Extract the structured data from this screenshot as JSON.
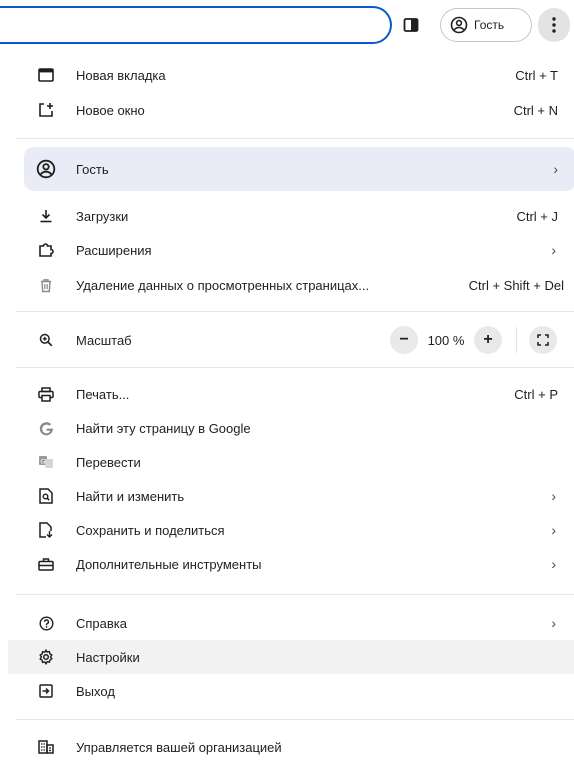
{
  "toolbar": {
    "profile_label": "Гость"
  },
  "menu": {
    "new_tab": {
      "label": "Новая вкладка",
      "shortcut": "Ctrl + T"
    },
    "new_window": {
      "label": "Новое окно",
      "shortcut": "Ctrl + N"
    },
    "profile": {
      "label": "Гость",
      "chevron": "›"
    },
    "downloads": {
      "label": "Загрузки",
      "shortcut": "Ctrl + J"
    },
    "extensions": {
      "label": "Расширения",
      "chevron": "›"
    },
    "clear_data": {
      "label": "Удаление данных о просмотренных страницах...",
      "shortcut": "Ctrl + Shift + Del"
    },
    "zoom": {
      "label": "Масштаб",
      "minus": "−",
      "value": "100 %",
      "plus": "+"
    },
    "print": {
      "label": "Печать...",
      "shortcut": "Ctrl + P"
    },
    "search_google": {
      "label": "Найти эту страницу в Google"
    },
    "translate": {
      "label": "Перевести"
    },
    "find_edit": {
      "label": "Найти и изменить",
      "chevron": "›"
    },
    "save_share": {
      "label": "Сохранить и поделиться",
      "chevron": "›"
    },
    "more_tools": {
      "label": "Дополнительные инструменты",
      "chevron": "›"
    },
    "help": {
      "label": "Справка",
      "chevron": "›"
    },
    "settings": {
      "label": "Настройки"
    },
    "exit": {
      "label": "Выход"
    },
    "managed": {
      "label": "Управляется вашей организацией"
    }
  }
}
